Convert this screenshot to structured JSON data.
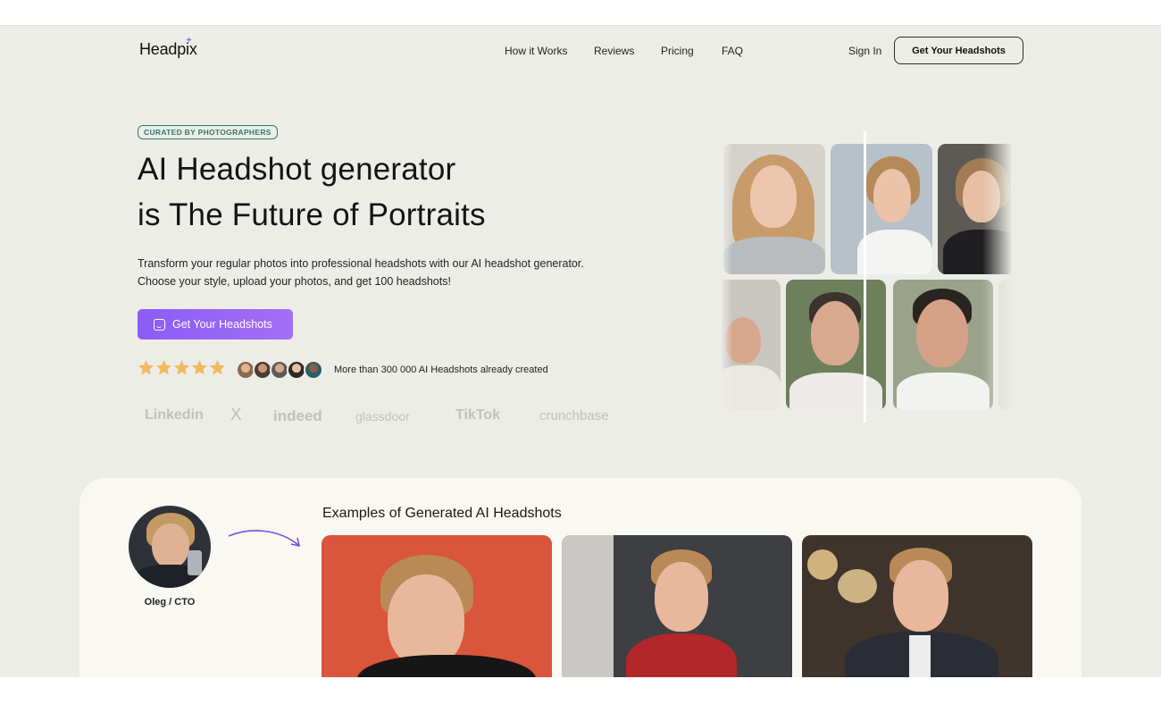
{
  "brand": {
    "name": "Headpix",
    "accent_color": "#8b5cf6"
  },
  "nav": {
    "links": [
      "How it Works",
      "Reviews",
      "Pricing",
      "FAQ"
    ],
    "sign_in": "Sign In",
    "cta": "Get Your Headshots"
  },
  "hero": {
    "badge": "CURATED BY PHOTOGRAPHERS",
    "headline_line1": "AI Headshot generator",
    "headline_line2": "is The Future of Portraits",
    "subtext_line1": "Transform your regular photos into professional headshots with our AI headshot generator.",
    "subtext_line2": "Choose your style, upload your photos, and get 100 headshots!",
    "cta": "Get Your Headshots",
    "rating_stars": 5,
    "created_text": "More than 300 000 AI Headshots already created",
    "brands": [
      "Linkedin",
      "X",
      "indeed",
      "glassdoor",
      "TikTok",
      "crunchbase"
    ]
  },
  "examples": {
    "title": "Examples of Generated AI Headshots",
    "person_name": "Oleg / CTO"
  }
}
